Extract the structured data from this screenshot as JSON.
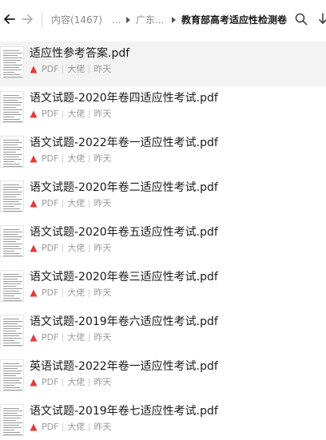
{
  "breadcrumb": {
    "root": "内容(1467)",
    "ellipsis": "...",
    "middle": "广东...",
    "current": "教育部高考适应性检测卷"
  },
  "colors": {
    "pdf_icon": "#e03b3b",
    "selected_row": "#f3f3f3"
  },
  "icons": {
    "back": "arrow-left-icon",
    "forward": "arrow-right-icon",
    "search": "search-icon",
    "more": "arrow-down-icon",
    "file_type": "pdf-icon"
  },
  "files": [
    {
      "name": "适应性参考答案.pdf",
      "type": "PDF",
      "owner": "大佬",
      "time": "昨天",
      "selected": true
    },
    {
      "name": "语文试题-2020年卷四适应性考试.pdf",
      "type": "PDF",
      "owner": "大佬",
      "time": "昨天"
    },
    {
      "name": "语文试题-2022年卷一适应性考试.pdf",
      "type": "PDF",
      "owner": "大佬",
      "time": "昨天"
    },
    {
      "name": "语文试题-2020年卷二适应性考试.pdf",
      "type": "PDF",
      "owner": "大佬",
      "time": "昨天"
    },
    {
      "name": "语文试题-2020年卷五适应性考试.pdf",
      "type": "PDF",
      "owner": "大佬",
      "time": "昨天"
    },
    {
      "name": "语文试题-2020年卷三适应性考试.pdf",
      "type": "PDF",
      "owner": "大佬",
      "time": "昨天"
    },
    {
      "name": "语文试题-2019年卷六适应性考试.pdf",
      "type": "PDF",
      "owner": "大佬",
      "time": "昨天"
    },
    {
      "name": "英语试题-2022年卷一适应性考试.pdf",
      "type": "PDF",
      "owner": "大佬",
      "time": "昨天"
    },
    {
      "name": "语文试题-2019年卷七适应性考试.pdf",
      "type": "PDF",
      "owner": "大佬",
      "time": "昨天"
    }
  ]
}
